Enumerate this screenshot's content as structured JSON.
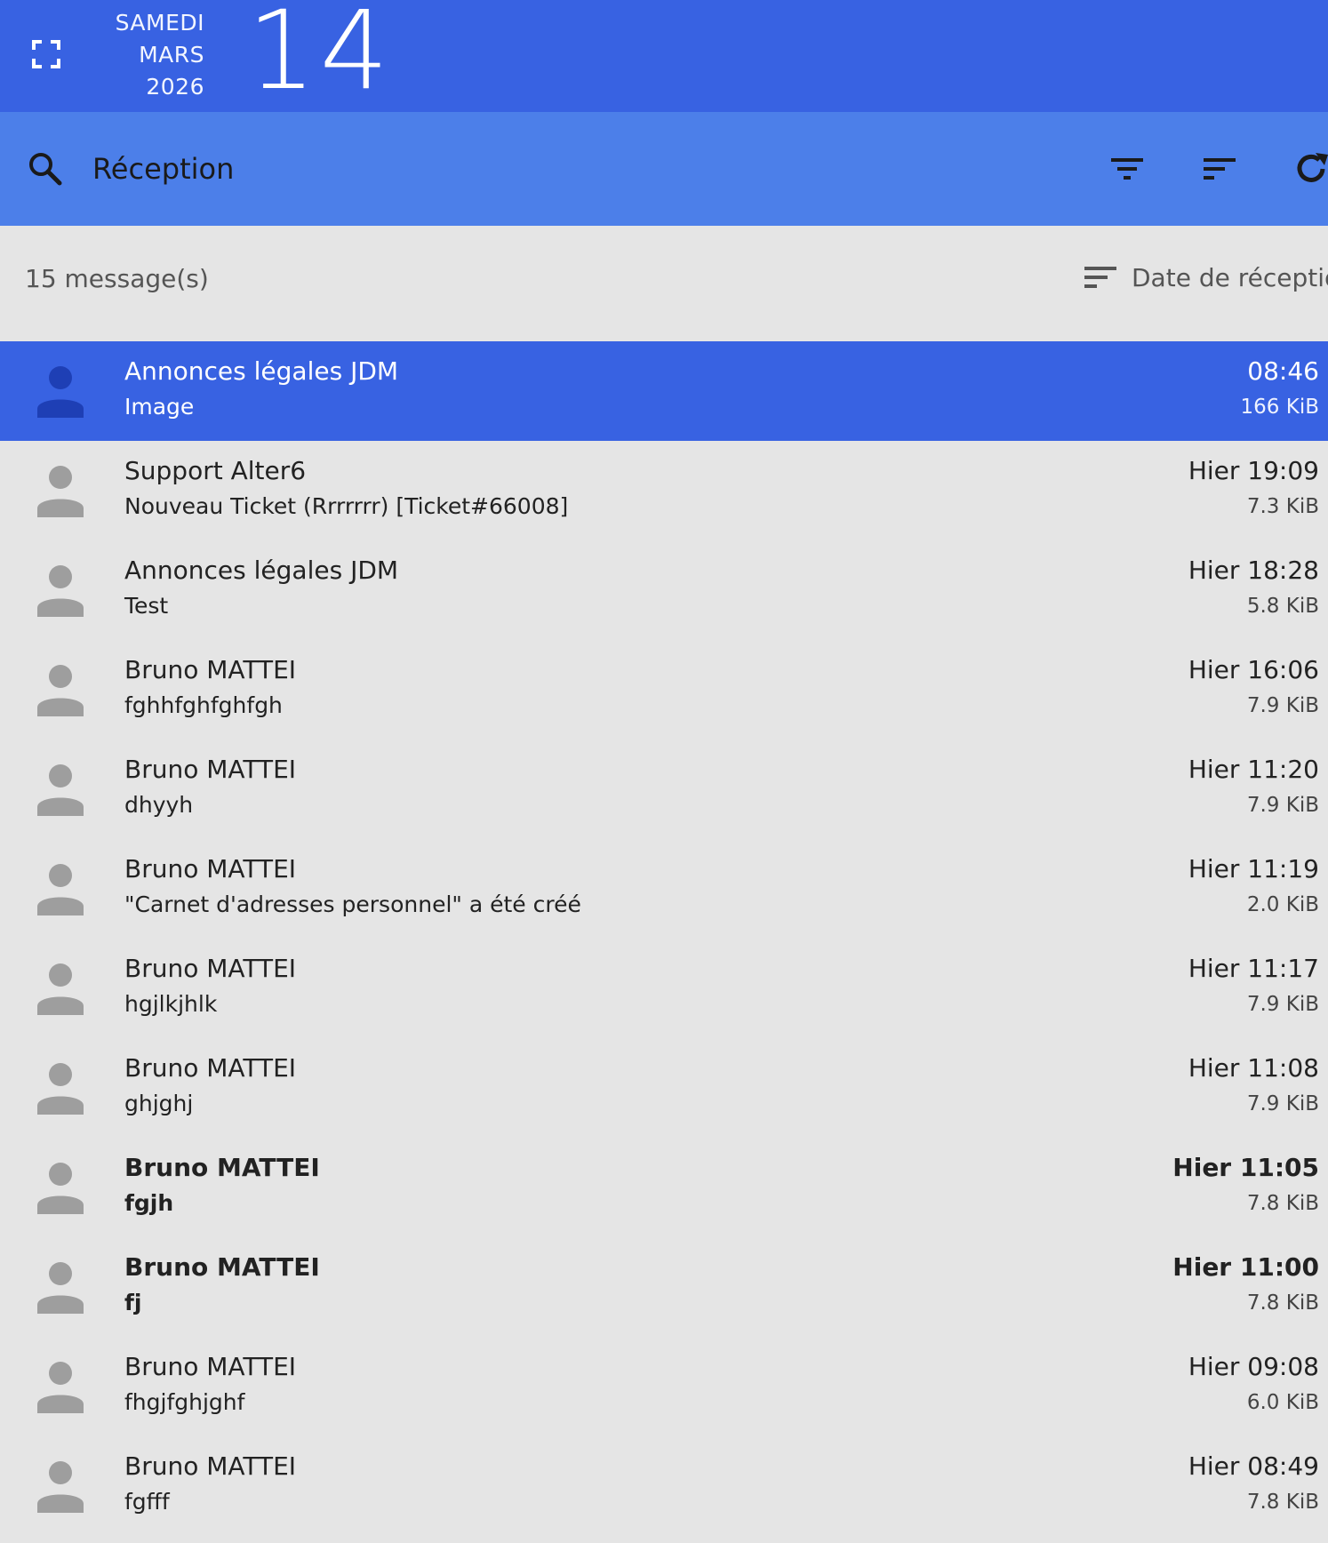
{
  "header": {
    "weekday": "SAMEDI",
    "month": "MARS",
    "year": "2026",
    "day": "14",
    "fullscreen_icon": "fullscreen-icon"
  },
  "toolbar": {
    "search_icon": "search-icon",
    "folder_name": "Réception",
    "filter_icon": "filter-icon",
    "sort_icon": "sort-icon",
    "refresh_icon": "refresh-icon"
  },
  "list_header": {
    "count": "15 message(s)",
    "sort_label": "Date de réception"
  },
  "colors": {
    "topbar": "#3862e2",
    "toolbar": "#4c7fe9",
    "selected_row": "#3862e2",
    "avatar": "#9e9e9e",
    "selected_avatar": "#1e3fb5",
    "background": "#e5e5e5"
  },
  "messages": [
    {
      "sender": "Annonces légales JDM",
      "subject": "Image",
      "time": "08:46",
      "size": "166 KiB",
      "selected": true,
      "unread": false
    },
    {
      "sender": "Support Alter6",
      "subject": "Nouveau Ticket (Rrrrrrr) [Ticket#66008]",
      "time": "Hier 19:09",
      "size": "7.3 KiB",
      "selected": false,
      "unread": false
    },
    {
      "sender": "Annonces légales JDM",
      "subject": "Test",
      "time": "Hier 18:28",
      "size": "5.8 KiB",
      "selected": false,
      "unread": false
    },
    {
      "sender": "Bruno MATTEI",
      "subject": "fghhfghfghfgh",
      "time": "Hier 16:06",
      "size": "7.9 KiB",
      "selected": false,
      "unread": false
    },
    {
      "sender": "Bruno MATTEI",
      "subject": "dhyyh",
      "time": "Hier 11:20",
      "size": "7.9 KiB",
      "selected": false,
      "unread": false
    },
    {
      "sender": "Bruno MATTEI",
      "subject": "\"Carnet d'adresses personnel\" a été créé",
      "time": "Hier 11:19",
      "size": "2.0 KiB",
      "selected": false,
      "unread": false
    },
    {
      "sender": "Bruno MATTEI",
      "subject": "hgjlkjhlk",
      "time": "Hier 11:17",
      "size": "7.9 KiB",
      "selected": false,
      "unread": false
    },
    {
      "sender": "Bruno MATTEI",
      "subject": "ghjghj",
      "time": "Hier 11:08",
      "size": "7.9 KiB",
      "selected": false,
      "unread": false
    },
    {
      "sender": "Bruno MATTEI",
      "subject": "fgjh",
      "time": "Hier 11:05",
      "size": "7.8 KiB",
      "selected": false,
      "unread": true
    },
    {
      "sender": "Bruno MATTEI",
      "subject": "fj",
      "time": "Hier 11:00",
      "size": "7.8 KiB",
      "selected": false,
      "unread": true
    },
    {
      "sender": "Bruno MATTEI",
      "subject": "fhgjfghjghf",
      "time": "Hier 09:08",
      "size": "6.0 KiB",
      "selected": false,
      "unread": false
    },
    {
      "sender": "Bruno MATTEI",
      "subject": "fgfff",
      "time": "Hier 08:49",
      "size": "7.8 KiB",
      "selected": false,
      "unread": false
    }
  ]
}
